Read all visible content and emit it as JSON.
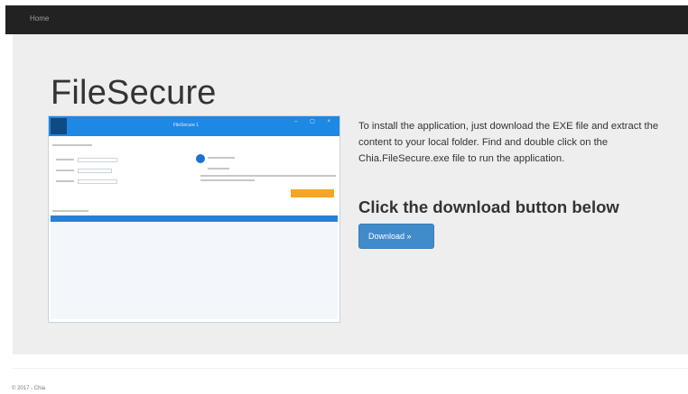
{
  "nav": {
    "home_label": "Home"
  },
  "page": {
    "title": "FileSecure",
    "description": "To install the application, just download the EXE file and extract the content to your local folder. Find and double click on the Chia.FileSecure.exe file to run the application.",
    "subheading": "Click the download button below",
    "download_label": "Download »"
  },
  "app_screenshot": {
    "window_title": "FileSecure 1",
    "window_buttons": "– ▢ ×"
  },
  "footer": {
    "copyright": "© 2017 - Chia"
  },
  "colors": {
    "navbar": "#222222",
    "jumbotron": "#eeeeee",
    "button": "#428bca",
    "app_titlebar": "#1e88e5"
  }
}
